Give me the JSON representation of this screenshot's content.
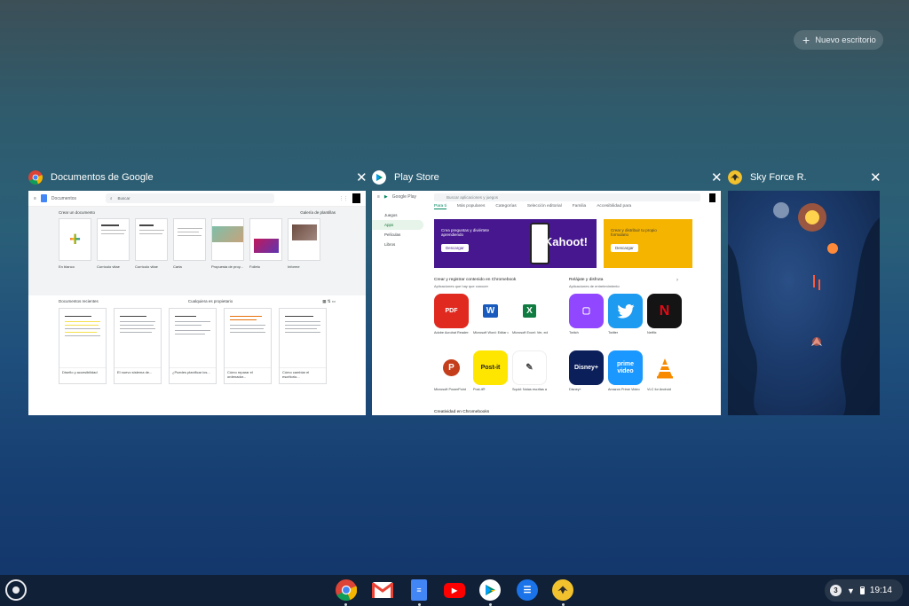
{
  "new_desk": {
    "label": "Nuevo escritorio"
  },
  "windows": [
    {
      "title": "Documentos de Google"
    },
    {
      "title": "Play Store"
    },
    {
      "title": "Sky Force R."
    }
  ],
  "docs": {
    "app_name": "Documentos",
    "search_placeholder": "Buscar",
    "new_doc_label": "Crear un documento",
    "gallery_label": "Galería de plantillas",
    "templates": [
      "En blanco",
      "Currículo vitae",
      "Currículo vitae",
      "Carta",
      "Propuesta de proy...",
      "Folleto",
      "Informe"
    ],
    "recent_label": "Documentos recientes",
    "owner_filter": "Cualquiera es propietario",
    "recent_docs": [
      "Diseño y accesibilidad",
      "El nuevo sistema de...",
      "¿Puedes planificar los...",
      "Cómo reparar el ordenador...",
      "Cómo cambiar el escritorio..."
    ]
  },
  "play": {
    "brand": "Google Play",
    "search_placeholder": "Buscar aplicaciones y juegos",
    "side": [
      "Juegos",
      "Apps",
      "Películas",
      "Libros"
    ],
    "tabs": [
      "Para ti",
      "Más populares",
      "Categorías",
      "Selección editorial",
      "Familia",
      "Accesibilidad para"
    ],
    "banner1": {
      "text": "Crea preguntas y diviértete aprendiendo",
      "button": "Descargar",
      "brand": "Kahoot!"
    },
    "banner2": {
      "text": "Crear y distribuir tu propio formulario",
      "button": "Descargar"
    },
    "section1": {
      "title": "Crear y registrar contenido en Chromebook",
      "sub": "Aplicaciones que hay que conocer"
    },
    "section2": {
      "title": "Relájate y disfruta",
      "sub": "Aplicaciones de entretenimiento"
    },
    "section3": {
      "title": "Creatividad en Chromebooks"
    },
    "apps_left": [
      {
        "name": "Adobe Acrobat Reader: Editor de PDF",
        "icon": "PDF",
        "color": "#e02a20"
      },
      {
        "name": "Microsoft Word: Editar documentos",
        "icon": "W",
        "color": "#ffffff"
      },
      {
        "name": "Microsoft Excel: Ver, editar",
        "icon": "X",
        "color": "#ffffff"
      },
      {
        "name": "Microsoft PowerPoint",
        "icon": "P",
        "color": "#ffffff"
      },
      {
        "name": "Post-it®",
        "icon": "Post-it",
        "color": "#ffe600"
      },
      {
        "name": "Squid: Notas escritas a mano",
        "icon": "✎",
        "color": "#ffffff"
      }
    ],
    "apps_right": [
      {
        "name": "Twitch",
        "icon": "twitch",
        "color": "#9146ff"
      },
      {
        "name": "Twitter",
        "icon": "twitter",
        "color": "#1d9bf0"
      },
      {
        "name": "Netflix",
        "icon": "N",
        "color": "#141414"
      },
      {
        "name": "Disney+",
        "icon": "Disney+",
        "color": "#0b1f5a"
      },
      {
        "name": "Amazon Prime Video",
        "icon": "prime video",
        "color": "#1a98ff"
      },
      {
        "name": "VLC for Android",
        "icon": "vlc",
        "color": "#ffffff"
      }
    ]
  },
  "tray": {
    "notifications": "3",
    "time": "19:14"
  }
}
